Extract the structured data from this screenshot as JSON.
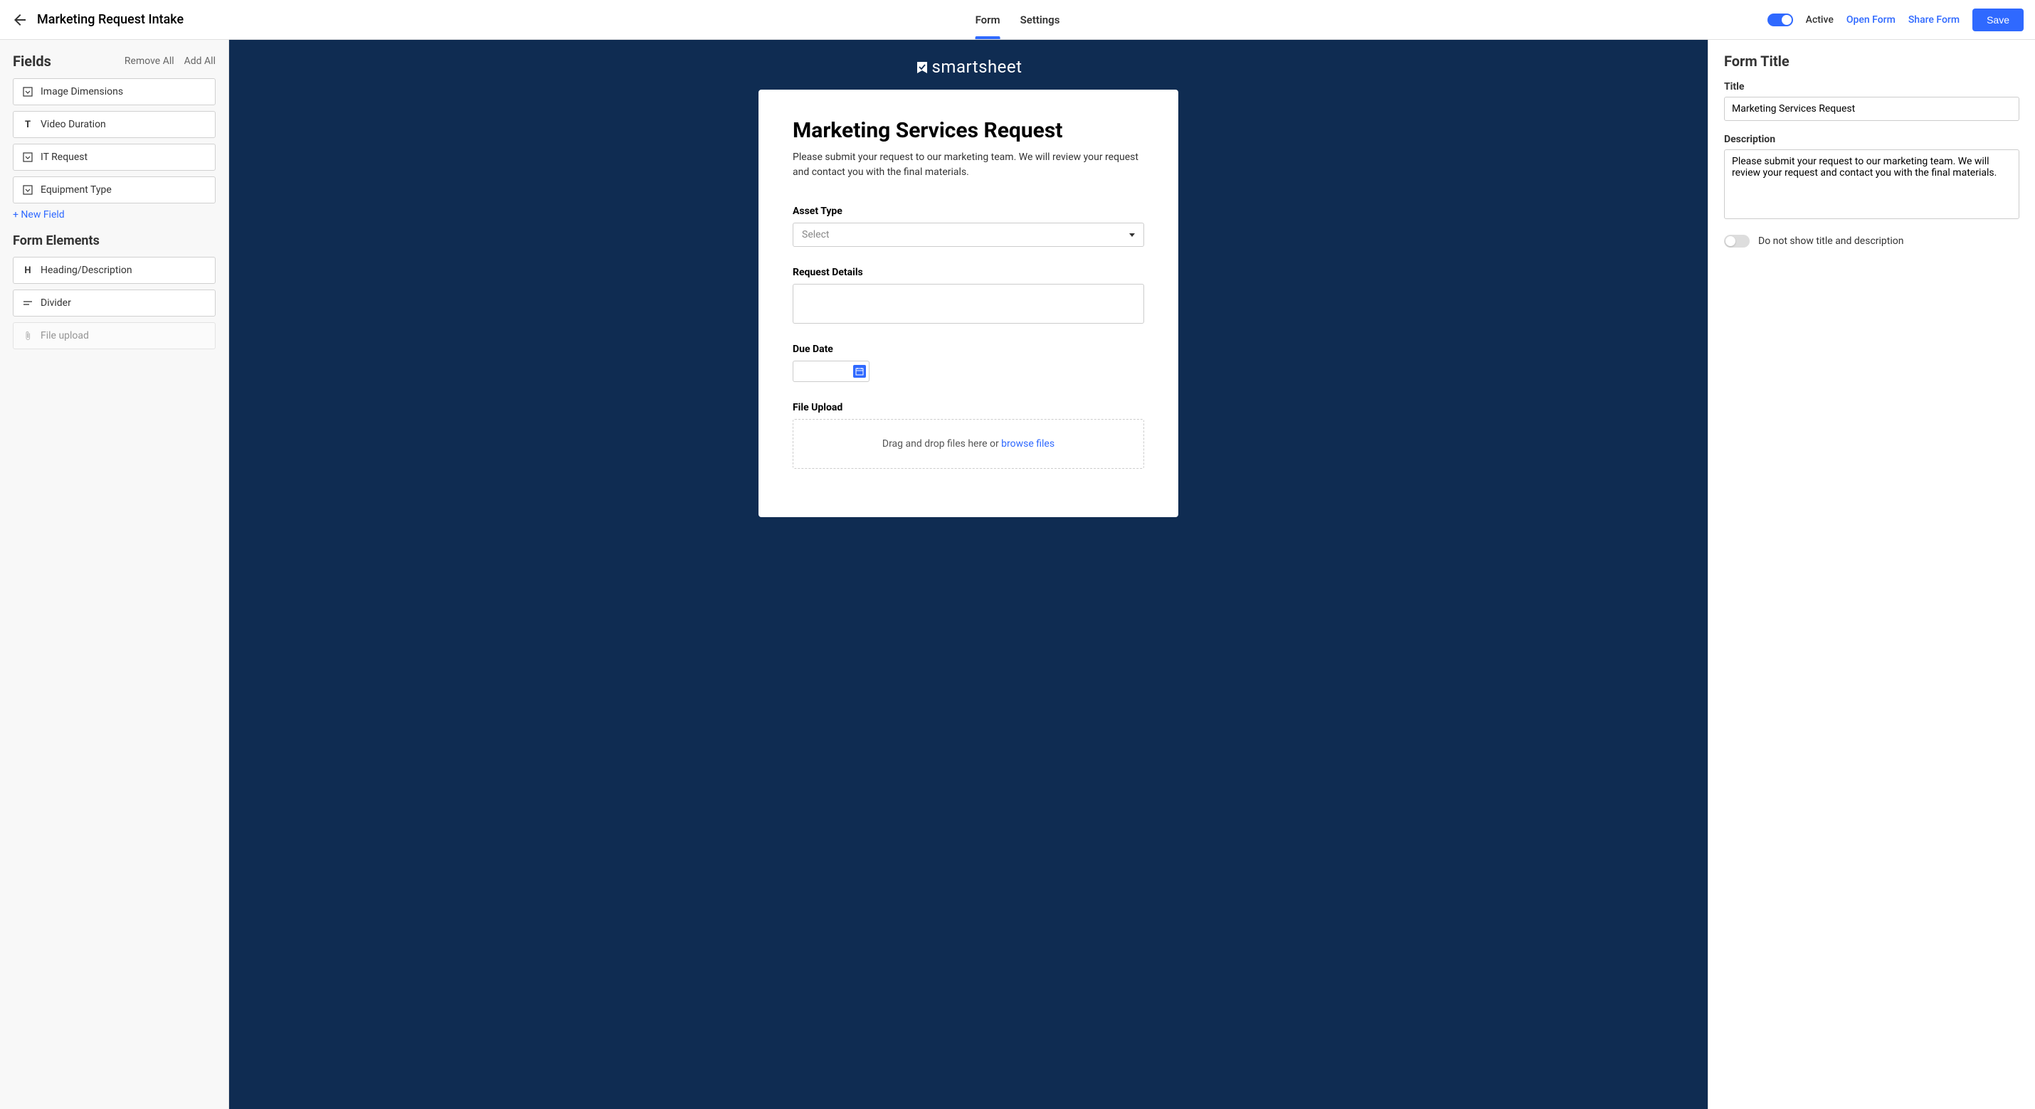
{
  "header": {
    "page_title": "Marketing Request Intake",
    "tabs": {
      "form": "Form",
      "settings": "Settings"
    },
    "active_label": "Active",
    "open_form": "Open Form",
    "share_form": "Share Form",
    "save": "Save"
  },
  "left": {
    "fields_title": "Fields",
    "remove_all": "Remove All",
    "add_all": "Add All",
    "fields": [
      {
        "label": "Image Dimensions",
        "icon": "dropdown"
      },
      {
        "label": "Video Duration",
        "icon": "text"
      },
      {
        "label": "IT Request",
        "icon": "dropdown"
      },
      {
        "label": "Equipment Type",
        "icon": "dropdown"
      }
    ],
    "new_field": "+ New Field",
    "elements_title": "Form Elements",
    "elements": [
      {
        "label": "Heading/Description",
        "icon": "heading"
      },
      {
        "label": "Divider",
        "icon": "divider"
      },
      {
        "label": "File upload",
        "icon": "attachment",
        "disabled": true
      }
    ]
  },
  "form": {
    "brand": "smartsheet",
    "title": "Marketing Services Request",
    "description": "Please submit your request to our marketing team. We will review your request and contact you with the final materials.",
    "asset_type_label": "Asset Type",
    "select_placeholder": "Select",
    "request_details_label": "Request Details",
    "due_date_label": "Due Date",
    "file_upload_label": "File Upload",
    "upload_text": "Drag and drop files here or ",
    "browse_link": "browse files"
  },
  "right": {
    "panel_title": "Form Title",
    "title_label": "Title",
    "title_value": "Marketing Services Request",
    "desc_label": "Description",
    "desc_value": "Please submit your request to our marketing team. We will review your request and contact you with the final materials.",
    "hide_title_label": "Do not show title and description"
  }
}
